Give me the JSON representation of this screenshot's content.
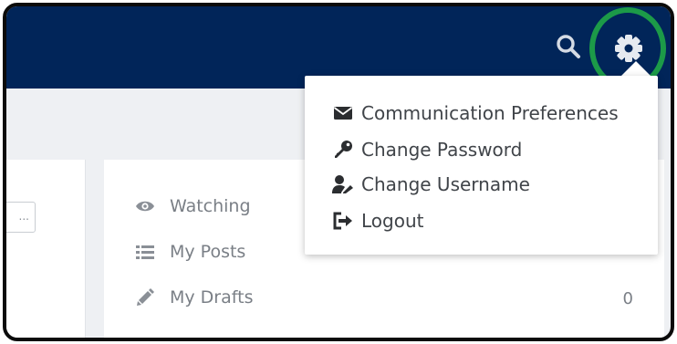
{
  "header": {
    "search_icon": "search-icon",
    "settings_icon": "gear-icon",
    "bar_color": "#012559",
    "highlight_color": "#1c9a48"
  },
  "settings_menu": {
    "items": [
      {
        "label": "Communication Preferences",
        "icon": "envelope-icon"
      },
      {
        "label": "Change Password",
        "icon": "key-icon"
      },
      {
        "label": "Change Username",
        "icon": "user-edit-icon"
      },
      {
        "label": "Logout",
        "icon": "sign-out-icon"
      }
    ]
  },
  "sidebar": {
    "items": [
      {
        "label": "Watching",
        "icon": "eye-icon"
      },
      {
        "label": "My Posts",
        "icon": "list-icon"
      },
      {
        "label": "My Drafts",
        "icon": "pencil-icon",
        "count": "0"
      }
    ]
  },
  "left_panel": {
    "input_fragment": "..."
  }
}
